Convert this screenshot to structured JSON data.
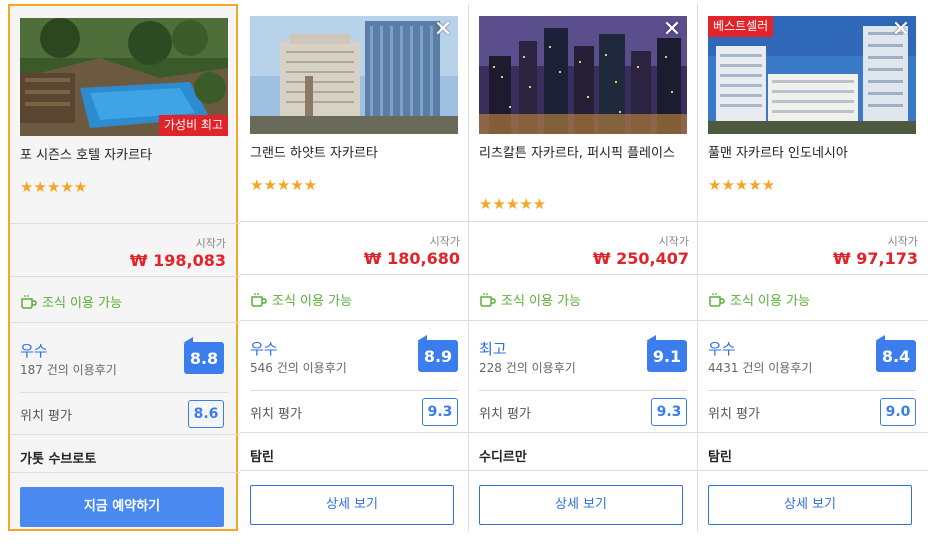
{
  "hotels": [
    {
      "name": "포 시즌스 호텔 자카르타",
      "ribbon": "가성비 최고",
      "stars": "★★★★★",
      "from_label": "시작가",
      "price": "₩ 198,083",
      "breakfast": "조식 이용 가능",
      "rating_word": "우수",
      "reviews": "187 건의 이용후기",
      "score": "8.8",
      "location_label": "위치 평가",
      "location_score": "8.6",
      "area": "가톳 수브로토",
      "button": "지금 예약하기"
    },
    {
      "name": "그랜드 하얏트 자카르타",
      "stars": "★★★★★",
      "from_label": "시작가",
      "price": "₩ 180,680",
      "breakfast": "조식 이용 가능",
      "rating_word": "우수",
      "reviews": "546 건의 이용후기",
      "score": "8.9",
      "location_label": "위치 평가",
      "location_score": "9.3",
      "area": "탐린",
      "button": "상세 보기"
    },
    {
      "name": "리츠칼튼 자카르타, 퍼시픽 플레이스",
      "stars": "★★★★★",
      "from_label": "시작가",
      "price": "₩ 250,407",
      "breakfast": "조식 이용 가능",
      "rating_word": "최고",
      "reviews": "228 건의 이용후기",
      "score": "9.1",
      "location_label": "위치 평가",
      "location_score": "9.3",
      "area": "수디르만",
      "button": "상세 보기"
    },
    {
      "name": "풀맨 자카르타 인도네시아",
      "ribbon": "베스트셀러",
      "stars": "★★★★★",
      "from_label": "시작가",
      "price": "₩ 97,173",
      "breakfast": "조식 이용 가능",
      "rating_word": "우수",
      "reviews": "4431 건의 이용후기",
      "score": "8.4",
      "location_label": "위치 평가",
      "location_score": "9.0",
      "area": "탐린",
      "button": "상세 보기"
    }
  ],
  "close_glyph": "✕",
  "colors": {
    "accent": "#3b7ded",
    "price": "#e0242a",
    "breakfast": "#5ab038",
    "highlight_border": "#f5a623",
    "star": "#f5a623"
  }
}
